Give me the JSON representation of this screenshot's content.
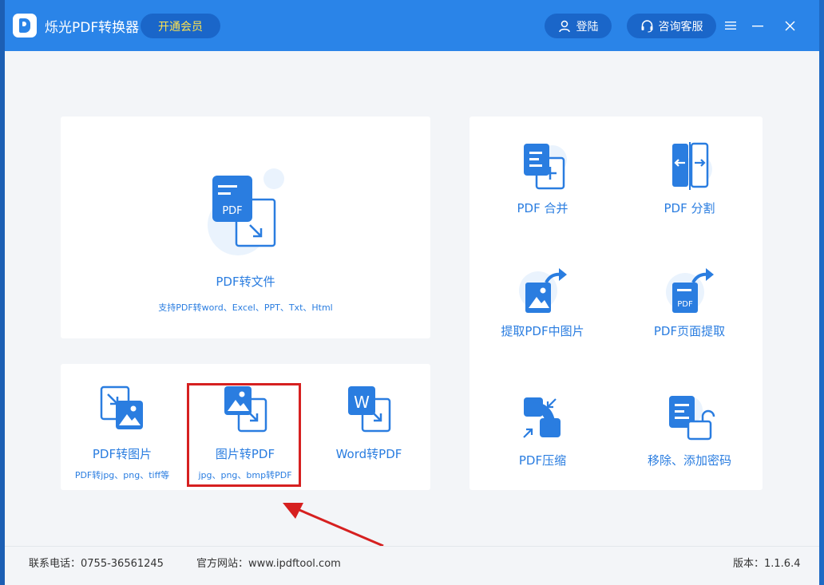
{
  "titlebar": {
    "app_name": "烁光PDF转换器",
    "vip_label": "开通会员",
    "login_label": "登陆",
    "service_label": "咨询客服"
  },
  "main_card": {
    "label": "PDF转文件",
    "sub": "支持PDF转word、Excel、PPT、Txt、Html",
    "icon_text": "PDF"
  },
  "small_tools": [
    {
      "label": "PDF转图片",
      "sub": "PDF转jpg、png、tiff等"
    },
    {
      "label": "图片转PDF",
      "sub": "jpg、png、bmp转PDF"
    },
    {
      "label": "Word转PDF",
      "sub": "",
      "icon_text": "W"
    }
  ],
  "right_tools": [
    {
      "label": "PDF 合并"
    },
    {
      "label": "PDF 分割"
    },
    {
      "label": "提取PDF中图片"
    },
    {
      "label": "PDF页面提取",
      "icon_text": "PDF"
    },
    {
      "label": "PDF压缩"
    },
    {
      "label": "移除、添加密码"
    }
  ],
  "footer": {
    "phone": "联系电话：0755-36561245",
    "website": "官方网站：www.ipdftool.com",
    "version": "版本：1.1.6.4"
  },
  "colors": {
    "titlebar": "#2a84e8",
    "accent": "#2a7de0",
    "highlight": "#d62020"
  }
}
